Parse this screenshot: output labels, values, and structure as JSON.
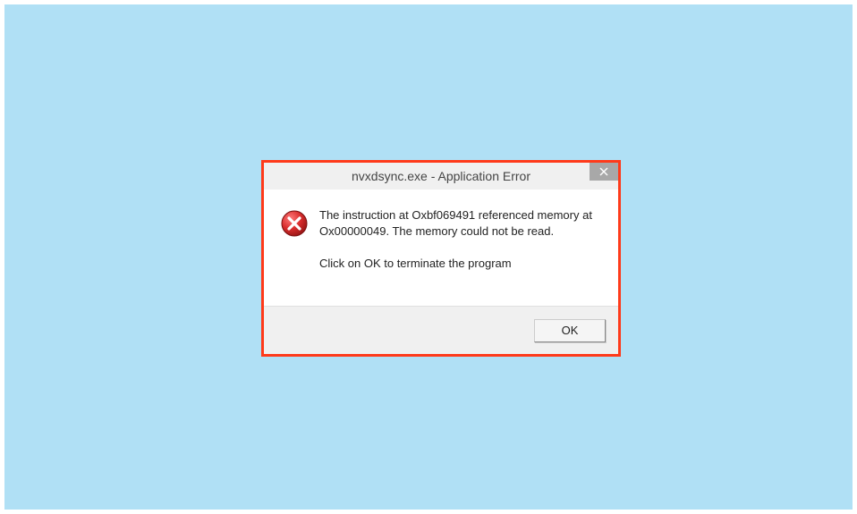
{
  "dialog": {
    "title": "nvxdsync.exe - Application Error",
    "message_line1": "The instruction at Oxbf069491 referenced memory at Ox00000049. The memory could not be read.",
    "message_line2": "Click on OK to terminate the program",
    "ok_label": "OK"
  },
  "colors": {
    "desktop_bg": "#b0e0f5",
    "highlight_border": "#ff3a1a",
    "error_red": "#d72c2c"
  }
}
